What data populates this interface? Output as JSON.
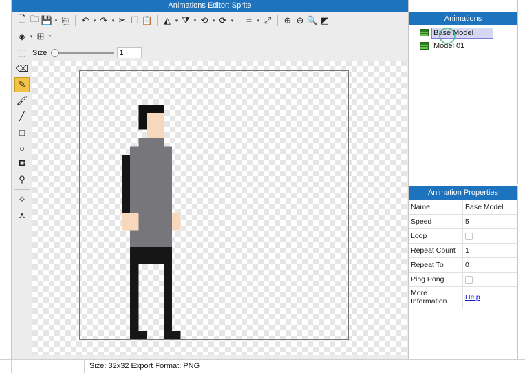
{
  "window": {
    "title": "Animations Editor: Sprite"
  },
  "toolbar": {
    "row1": [
      {
        "name": "new-file-icon",
        "glyph": "🗋",
        "drop": false
      },
      {
        "name": "open-folder-icon",
        "glyph": "🗀",
        "drop": false
      },
      {
        "name": "save-icon",
        "glyph": "💾",
        "drop": true
      },
      {
        "name": "export-icon",
        "glyph": "⎘",
        "drop": false
      },
      {
        "sep": true
      },
      {
        "name": "undo-icon",
        "glyph": "↶",
        "drop": true
      },
      {
        "name": "redo-icon",
        "glyph": "↷",
        "drop": true
      },
      {
        "name": "cut-icon",
        "glyph": "✂",
        "drop": false
      },
      {
        "name": "copy-icon",
        "glyph": "❐",
        "drop": false
      },
      {
        "name": "paste-icon",
        "glyph": "📋",
        "drop": false
      },
      {
        "sep": true
      },
      {
        "name": "flip-horizontal-icon",
        "glyph": "◭",
        "drop": true
      },
      {
        "name": "flip-vertical-icon",
        "glyph": "⧩",
        "drop": true
      },
      {
        "name": "rotate-left-icon",
        "glyph": "⟲",
        "drop": true
      },
      {
        "name": "rotate-right-icon",
        "glyph": "⟳",
        "drop": true
      },
      {
        "sep": true
      },
      {
        "name": "crop-icon",
        "glyph": "⌗",
        "drop": true
      },
      {
        "name": "resize-icon",
        "glyph": "⤢",
        "drop": false
      },
      {
        "sep": true
      },
      {
        "name": "zoom-in-icon",
        "glyph": "⊕",
        "drop": false
      },
      {
        "name": "zoom-out-icon",
        "glyph": "⊖",
        "drop": false
      },
      {
        "name": "zoom-fit-icon",
        "glyph": "🔍",
        "drop": false
      },
      {
        "name": "zoom-actual-icon",
        "glyph": "◩",
        "drop": false
      }
    ],
    "row2": [
      {
        "name": "layers-icon",
        "glyph": "◈",
        "drop": true
      },
      {
        "name": "grid-icon",
        "glyph": "⊞",
        "drop": true
      }
    ],
    "size_label": "Size",
    "size_value": "1",
    "brush_size": 1
  },
  "tools": [
    {
      "name": "eraser-icon",
      "glyph": "⌫",
      "active": false
    },
    {
      "name": "pencil-icon",
      "glyph": "✎",
      "active": true
    },
    {
      "name": "brush-icon",
      "glyph": "🖌",
      "active": false
    },
    {
      "name": "line-icon",
      "glyph": "╱",
      "active": false
    },
    {
      "name": "rectangle-icon",
      "glyph": "□",
      "active": false
    },
    {
      "name": "ellipse-icon",
      "glyph": "○",
      "active": false
    },
    {
      "name": "fill-bucket-icon",
      "glyph": "⛾",
      "active": false
    },
    {
      "name": "eyedropper-icon",
      "glyph": "⚲",
      "active": false
    },
    {
      "sep": true
    },
    {
      "name": "move-point-icon",
      "glyph": "✧",
      "active": false
    },
    {
      "name": "origin-icon",
      "glyph": "⋏",
      "active": false
    }
  ],
  "sprite": {
    "colors": {
      "hair": "#111111",
      "skin": "#f8d8bc",
      "shirt": "#77767a",
      "dark": "#161616"
    }
  },
  "status": {
    "text": "Size: 32x32   Export Format: PNG"
  },
  "animations_panel": {
    "title": "Animations",
    "items": [
      {
        "label": "Base Model",
        "selected": true
      },
      {
        "label": "Model 01",
        "selected": false
      }
    ]
  },
  "properties_panel": {
    "title": "Animation Properties",
    "rows": [
      {
        "name": "Name",
        "value": "Base Model",
        "type": "text"
      },
      {
        "name": "Speed",
        "value": "5",
        "type": "text"
      },
      {
        "name": "Loop",
        "value": "",
        "type": "checkbox"
      },
      {
        "name": "Repeat Count",
        "value": "1",
        "type": "text"
      },
      {
        "name": "Repeat To",
        "value": "0",
        "type": "text"
      },
      {
        "name": "Ping Pong",
        "value": "",
        "type": "checkbox"
      },
      {
        "name": "More Information",
        "value": "Help",
        "type": "link"
      }
    ]
  }
}
